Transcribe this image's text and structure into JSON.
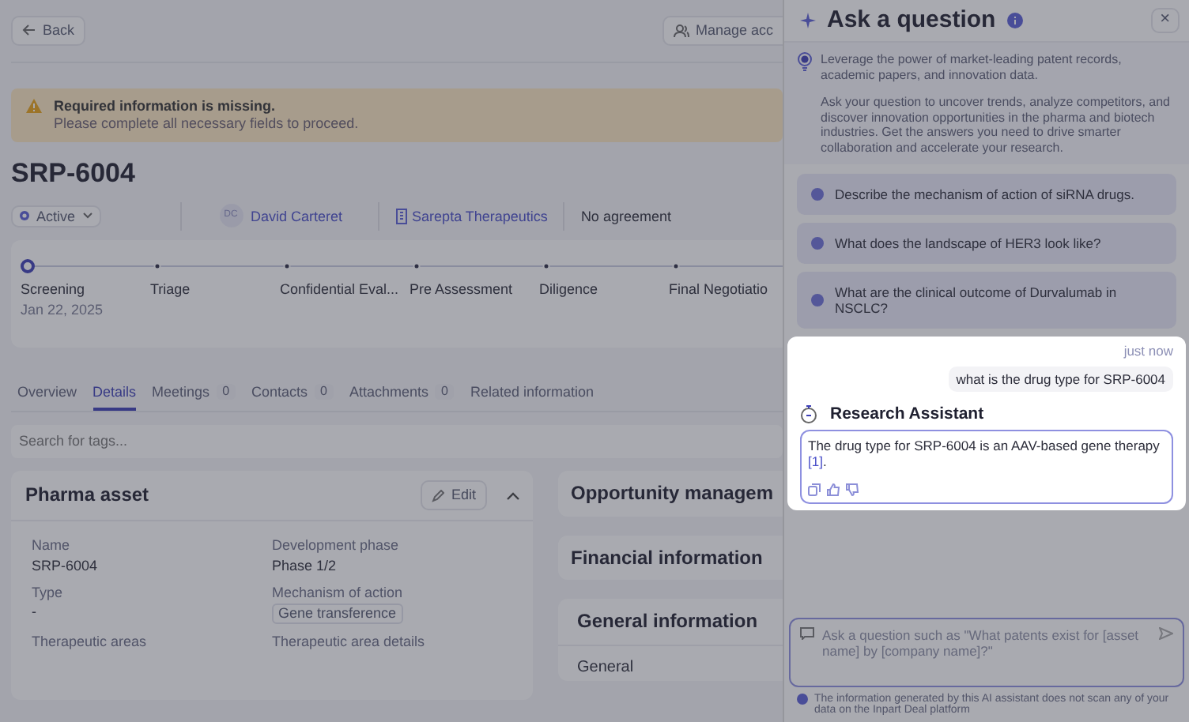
{
  "header": {
    "back_button": "Back",
    "manage_button": "Manage acc"
  },
  "alert": {
    "title": "Required information is missing.",
    "message": "Please complete all necessary fields to proceed."
  },
  "asset": {
    "title": "SRP-6004",
    "status": "Active",
    "owner_initials": "DC",
    "owner": "David Carteret",
    "company": "Sarepta Therapeutics",
    "agreement": "No agreement"
  },
  "stages": [
    {
      "label": "Screening",
      "date": "Jan 22, 2025",
      "selected": true
    },
    {
      "label": "Triage",
      "selected": false
    },
    {
      "label": "Confidential Eval...",
      "selected": false
    },
    {
      "label": "Pre Assessment",
      "selected": false
    },
    {
      "label": "Diligence",
      "selected": false
    },
    {
      "label": "Final Negotiatio",
      "selected": false
    }
  ],
  "tabs": [
    {
      "label": "Overview",
      "selected": false
    },
    {
      "label": "Details",
      "selected": true
    },
    {
      "label": "Meetings",
      "count": "0",
      "selected": false
    },
    {
      "label": "Contacts",
      "count": "0",
      "selected": false
    },
    {
      "label": "Attachments",
      "count": "0",
      "selected": false
    },
    {
      "label": "Related information",
      "selected": false
    }
  ],
  "tag_search": {
    "placeholder": "Search for tags..."
  },
  "pharma_asset": {
    "title": "Pharma asset",
    "edit_button": "Edit",
    "expanded": true,
    "fields": [
      {
        "label": "Name",
        "value": "SRP-6004",
        "kind": "text"
      },
      {
        "label": "Development phase",
        "value": "Phase 1/2",
        "kind": "text"
      },
      {
        "label": "Type",
        "value": "-",
        "kind": "text"
      },
      {
        "label": "Mechanism of action",
        "value": "Gene transference",
        "kind": "tag"
      },
      {
        "label": "Therapeutic areas"
      },
      {
        "label": "Therapeutic area details"
      }
    ]
  },
  "side_cards": [
    {
      "title": "Opportunity managem"
    },
    {
      "title": "Financial information"
    },
    {
      "title": "General information",
      "subtitle": "General"
    }
  ],
  "assistant": {
    "title": "Ask a question",
    "close_button": "×",
    "intro": [
      "Leverage the power of  market-leading patent records, academic papers, and innovation data.",
      "Ask your question to uncover trends, analyze competitors, and discover innovation opportunities in the pharma and biotech industries. Get the answers you need to drive smarter collaboration and accelerate your research."
    ],
    "suggestions": [
      "Describe the mechanism of action of siRNA drugs.",
      "What does the landscape of HER3 look like?",
      "What are the clinical outcome of Durvalumab in NSCLC?"
    ],
    "message": {
      "time": "just now",
      "question": "what is the drug type for SRP-6004",
      "assistant_name": "Research Assistant",
      "answer": "The drug type for SRP-6004 is an AAV-based gene therapy",
      "citation": "[1]",
      "answer_end": "."
    },
    "input": {
      "placeholder": "Ask a question such as \"What patents exist for [asset name] by [company name]?\""
    },
    "disclaimer": "The information generated by this AI assistant does not scan any of your data on the Inpart Deal platform"
  }
}
